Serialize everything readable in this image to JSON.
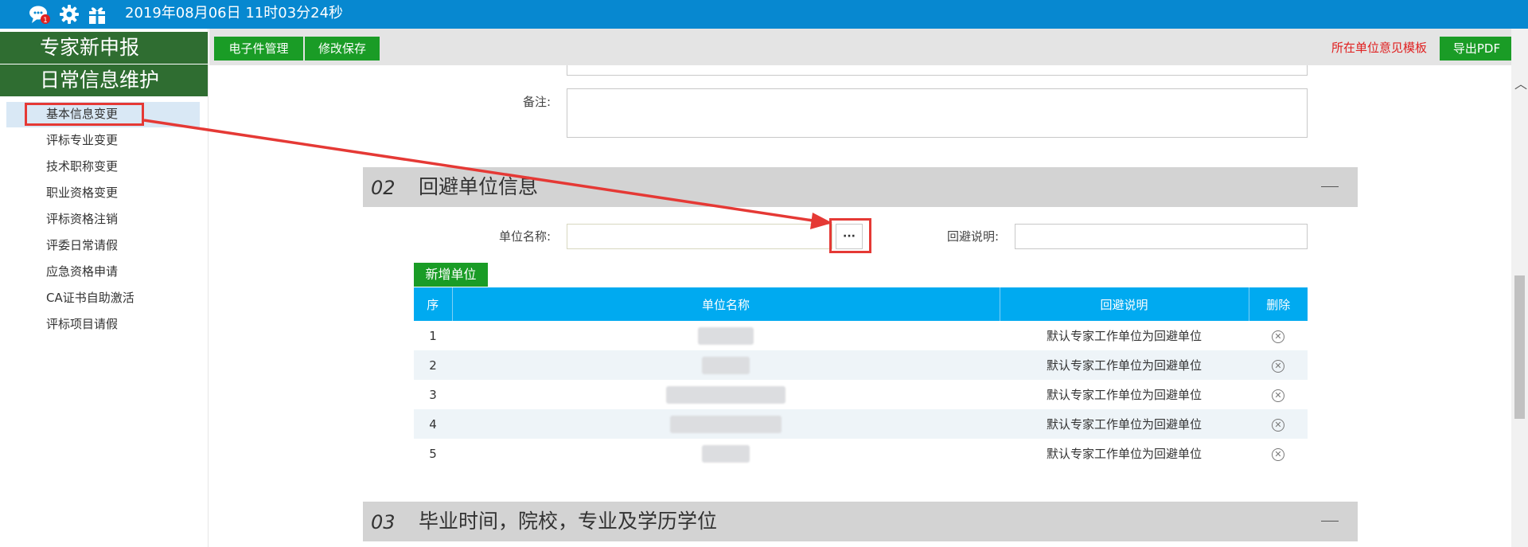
{
  "topbar": {
    "datetime": "2019年08月06日 11时03分24秒",
    "icons": [
      "chat-notification-icon",
      "gear-icon",
      "gift-icon"
    ],
    "notification_badge": "1"
  },
  "sidebar": {
    "headers": [
      "专家新申报",
      "日常信息维护"
    ],
    "items": [
      "基本信息变更",
      "评标专业变更",
      "技术职称变更",
      "职业资格变更",
      "评标资格注销",
      "评委日常请假",
      "应急资格申请",
      "CA证书自助激活",
      "评标项目请假"
    ],
    "active_index": 0
  },
  "toolbar": {
    "buttons": [
      "电子件管理",
      "修改保存"
    ],
    "template_link": "所在单位意见模板",
    "export_button": "导出PDF"
  },
  "form": {
    "remark_label": "备注:",
    "unit_name_label": "单位名称:",
    "avoid_desc_label": "回避说明:",
    "picker_button": "···"
  },
  "sections": [
    {
      "num": "02",
      "title": "回避单位信息"
    },
    {
      "num": "03",
      "title": "毕业时间，院校，专业及学历学位"
    }
  ],
  "avoid_table": {
    "add_button": "新增单位",
    "headers": [
      "序",
      "单位名称",
      "回避说明",
      "删除"
    ],
    "rows": [
      {
        "seq": "1",
        "desc": "默认专家工作单位为回避单位"
      },
      {
        "seq": "2",
        "desc": "默认专家工作单位为回避单位"
      },
      {
        "seq": "3",
        "desc": "默认专家工作单位为回避单位"
      },
      {
        "seq": "4",
        "desc": "默认专家工作单位为回避单位"
      },
      {
        "seq": "5",
        "desc": "默认专家工作单位为回避单位"
      }
    ]
  },
  "colors": {
    "topbar": "#0788d0",
    "sidebar_header": "#2f6d31",
    "button_green": "#1a9c26",
    "table_header": "#00aaf0",
    "annotation_red": "#e53935"
  }
}
